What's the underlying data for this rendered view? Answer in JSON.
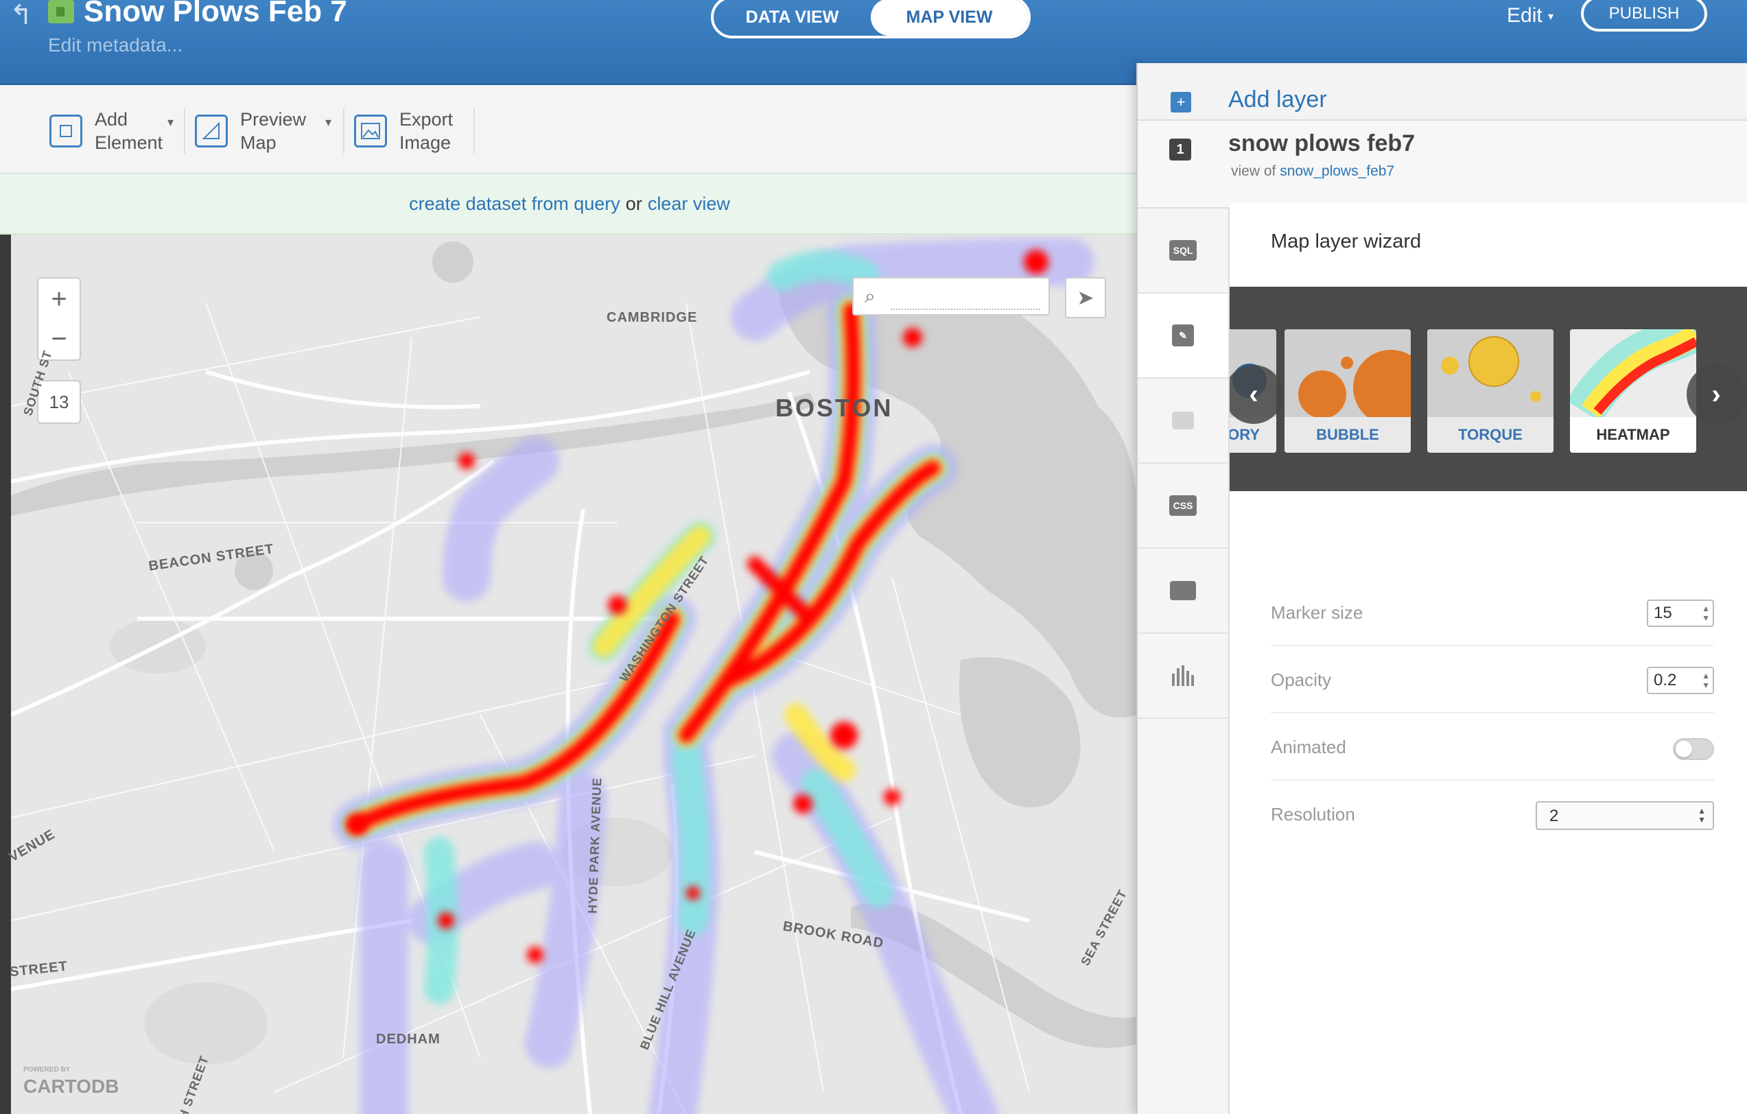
{
  "header": {
    "title": "Snow Plows Feb 7",
    "edit_metadata": "Edit metadata...",
    "tabs": [
      {
        "label": "DATA VIEW",
        "active": false
      },
      {
        "label": "MAP VIEW",
        "active": true
      }
    ],
    "edit_menu": "Edit",
    "publish": "PUBLISH"
  },
  "toolbar": {
    "add_element": "Add\nElement",
    "preview_map": "Preview\nMap",
    "export_image": "Export\nImage"
  },
  "notice": {
    "create_link": "create dataset from query",
    "or": "or",
    "clear_link": "clear view"
  },
  "map": {
    "zoom_in": "+",
    "zoom_out": "−",
    "zoom_level": "13",
    "search_placeholder": "",
    "attribution_small": "POWERED BY",
    "attribution": "CARTODB",
    "labels": {
      "cambridge": "CAMBRIDGE",
      "boston": "BOSTON",
      "beacon_street": "BEACON STREET",
      "washington_street": "WASHINGTON STREET",
      "hyde_park_avenue": "HYDE PARK AVENUE",
      "brook_road": "BROOK ROAD",
      "blue_hill_avenue": "BLUE HILL AVENUE",
      "sea_street": "SEA STREET",
      "dedham": "DEDHAM",
      "south_st": "SOUTH ST",
      "venue": "VENUE",
      "street": "STREET",
      "gh_street": "GH STREET"
    },
    "heat_colors": [
      "#ff0000",
      "#ffff00",
      "#7fffd4",
      "#9999ff"
    ]
  },
  "panel": {
    "add_layer": "Add layer",
    "layer": {
      "number": "1",
      "name": "snow plows feb7",
      "view_of": "view of",
      "source": "snow_plows_feb7"
    },
    "rail": {
      "sql": "SQL",
      "css": "CSS"
    },
    "wizard": {
      "title": "Map layer wizard",
      "types": [
        {
          "label": "EGORY",
          "active": false
        },
        {
          "label": "BUBBLE",
          "active": false
        },
        {
          "label": "TORQUE",
          "active": false
        },
        {
          "label": "HEATMAP",
          "active": true
        }
      ],
      "marker_size": {
        "label": "Marker size",
        "value": "15"
      },
      "opacity": {
        "label": "Opacity",
        "value": "0.2"
      },
      "animated": {
        "label": "Animated",
        "on": false
      },
      "resolution": {
        "label": "Resolution",
        "value": "2"
      }
    }
  }
}
